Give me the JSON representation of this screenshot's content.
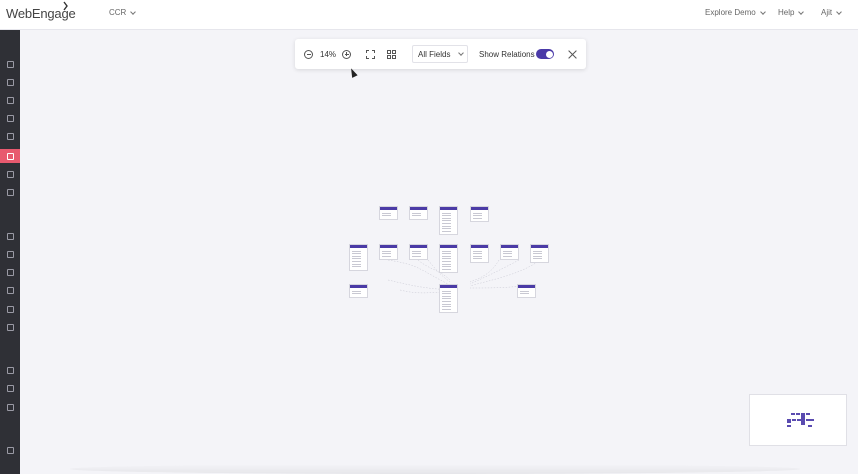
{
  "app": {
    "logo_text": "WebEngage",
    "workspace": "CCR"
  },
  "header": {
    "explore_demo": "Explore Demo",
    "help": "Help",
    "user": "Ajit"
  },
  "sidebar": {
    "items": [
      {
        "icon": "dashboard-icon"
      },
      {
        "icon": "users-icon"
      },
      {
        "icon": "journeys-icon"
      },
      {
        "icon": "analytics-icon"
      },
      {
        "icon": "segments-icon"
      },
      {
        "icon": "data-platform-icon",
        "active": true
      },
      {
        "icon": "catalog-icon"
      },
      {
        "icon": "rocket-icon"
      },
      {
        "icon": "eye-icon"
      },
      {
        "icon": "snowflake-icon"
      },
      {
        "icon": "campaigns-icon"
      },
      {
        "icon": "megaphone-icon"
      },
      {
        "icon": "mobile-icon"
      },
      {
        "icon": "flask-icon"
      },
      {
        "icon": "store-icon"
      },
      {
        "icon": "device-icon"
      },
      {
        "icon": "document-icon"
      },
      {
        "icon": "account-icon"
      }
    ]
  },
  "toolbar": {
    "zoom_level": "14%",
    "field_filter": "All Fields",
    "show_relations_label": "Show Relations",
    "show_relations_on": true
  },
  "colors": {
    "accent": "#4b3ba6",
    "sidebar_bg": "#2f3036",
    "sidebar_active": "#e85a6f",
    "canvas_bg": "#f4f4f8"
  }
}
